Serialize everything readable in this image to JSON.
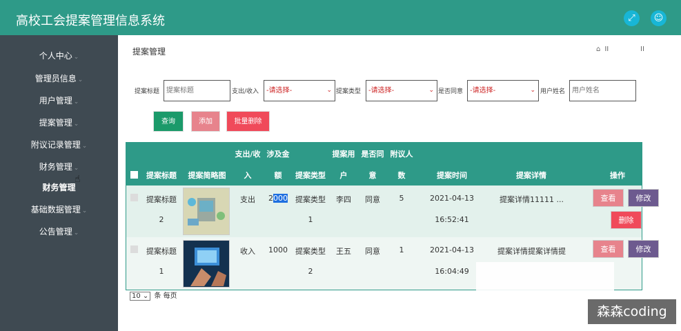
{
  "app": {
    "title": "高校工会提案管理信息系统"
  },
  "header": {
    "fullscreen_icon": "expand-icon",
    "user_icon": "user-icon"
  },
  "sidebar": {
    "items": [
      {
        "label": "个人中心"
      },
      {
        "label": "管理员信息"
      },
      {
        "label": "用户管理"
      },
      {
        "label": "提案管理"
      },
      {
        "label": "附议记录管理"
      },
      {
        "label": "财务管理"
      },
      {
        "label": "财务管理"
      },
      {
        "label": "基础数据管理"
      },
      {
        "label": "公告管理"
      }
    ]
  },
  "page": {
    "title": "提案管理",
    "crumb_sep": "II",
    "crumb_sep2": "II"
  },
  "filters": {
    "title_label": "提案标题",
    "title_placeholder": "提案标题",
    "inout_label": "支出/收入",
    "inout_value": "-请选择-",
    "type_label": "提案类型",
    "type_value": "-请选择-",
    "agree_label": "是否同意",
    "agree_value": "-请选择-",
    "user_label": "用户姓名",
    "user_placeholder": "用户姓名"
  },
  "actions": {
    "query": "查询",
    "add": "添加",
    "batch_delete": "批量删除"
  },
  "table": {
    "headers": {
      "title": "提案标题",
      "thumb": "提案简略图",
      "inout_a": "支出/收",
      "inout_b": "入",
      "amount_a": "涉及金",
      "amount_b": "额",
      "type": "提案类型",
      "user_a": "提案用",
      "user_b": "户",
      "agree_a": "是否同",
      "agree_b": "意",
      "count_a": "附议人",
      "count_b": "数",
      "time": "提案时间",
      "detail": "提案详情",
      "ops": "操作"
    },
    "rows": [
      {
        "title_a": "提案标题",
        "title_b": "2",
        "inout": "支出",
        "amount_a": "2",
        "amount_b": "000",
        "type_a": "提案类型",
        "type_b": "1",
        "user": "李四",
        "agree": "同意",
        "count": "5",
        "date": "2021-04-13",
        "time": "16:52:41",
        "detail": "提案详情11111 ...",
        "view": "查看",
        "edit": "修改",
        "delete": "删除"
      },
      {
        "title_a": "提案标题",
        "title_b": "1",
        "inout": "收入",
        "amount": "1000",
        "type_a": "提案类型",
        "type_b": "2",
        "user": "王五",
        "agree": "同意",
        "count": "1",
        "date": "2021-04-13",
        "time": "16:04:49",
        "detail": "提案详情提案详情提",
        "view": "查看",
        "edit": "修改"
      }
    ]
  },
  "pager": {
    "page_size": "10",
    "suffix": "条 每页"
  },
  "watermark": "森森coding"
}
